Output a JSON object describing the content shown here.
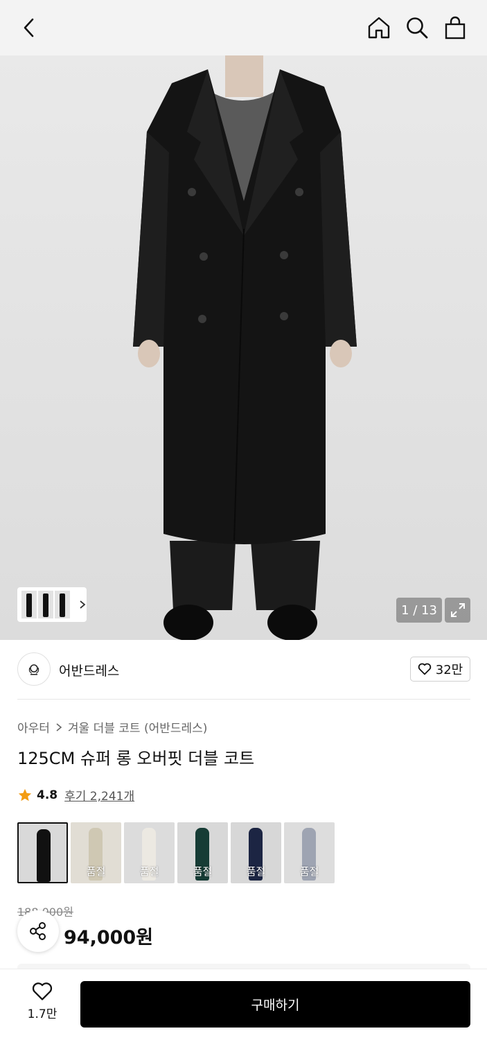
{
  "header": {
    "back_icon": "chevron-left-icon",
    "home_icon": "home-icon",
    "search_icon": "search-icon",
    "cart_icon": "shopping-bag-icon"
  },
  "gallery": {
    "counter": "1 / 13",
    "expand_icon": "expand-icon"
  },
  "brand": {
    "name": "어반드레스",
    "like_count": "32만"
  },
  "breadcrumb": {
    "category": "아우터",
    "subcategory": "겨울 더블 코트 (어반드레스)"
  },
  "product": {
    "title": "125CM 슈퍼 롱 오버핏 더블 코트",
    "rating": "4.8",
    "reviews": "후기 2,241개",
    "original_price": "188,000원",
    "sale_price": "94,000원"
  },
  "colors": [
    {
      "sold_out": "",
      "color": "#111111",
      "bg": "#d9d9d9"
    },
    {
      "sold_out": "품절",
      "color": "#cfc8b3",
      "bg": "#e1ddd4"
    },
    {
      "sold_out": "품절",
      "color": "#ece9e2",
      "bg": "#dcdcdc"
    },
    {
      "sold_out": "품절",
      "color": "#163c35",
      "bg": "#d8d8d8"
    },
    {
      "sold_out": "품절",
      "color": "#1c2543",
      "bg": "#d7d7d7"
    },
    {
      "sold_out": "품절",
      "color": "#9ea4b2",
      "bg": "#dddddd"
    }
  ],
  "bottom": {
    "wish_count": "1.7만",
    "buy_label": "구매하기"
  }
}
